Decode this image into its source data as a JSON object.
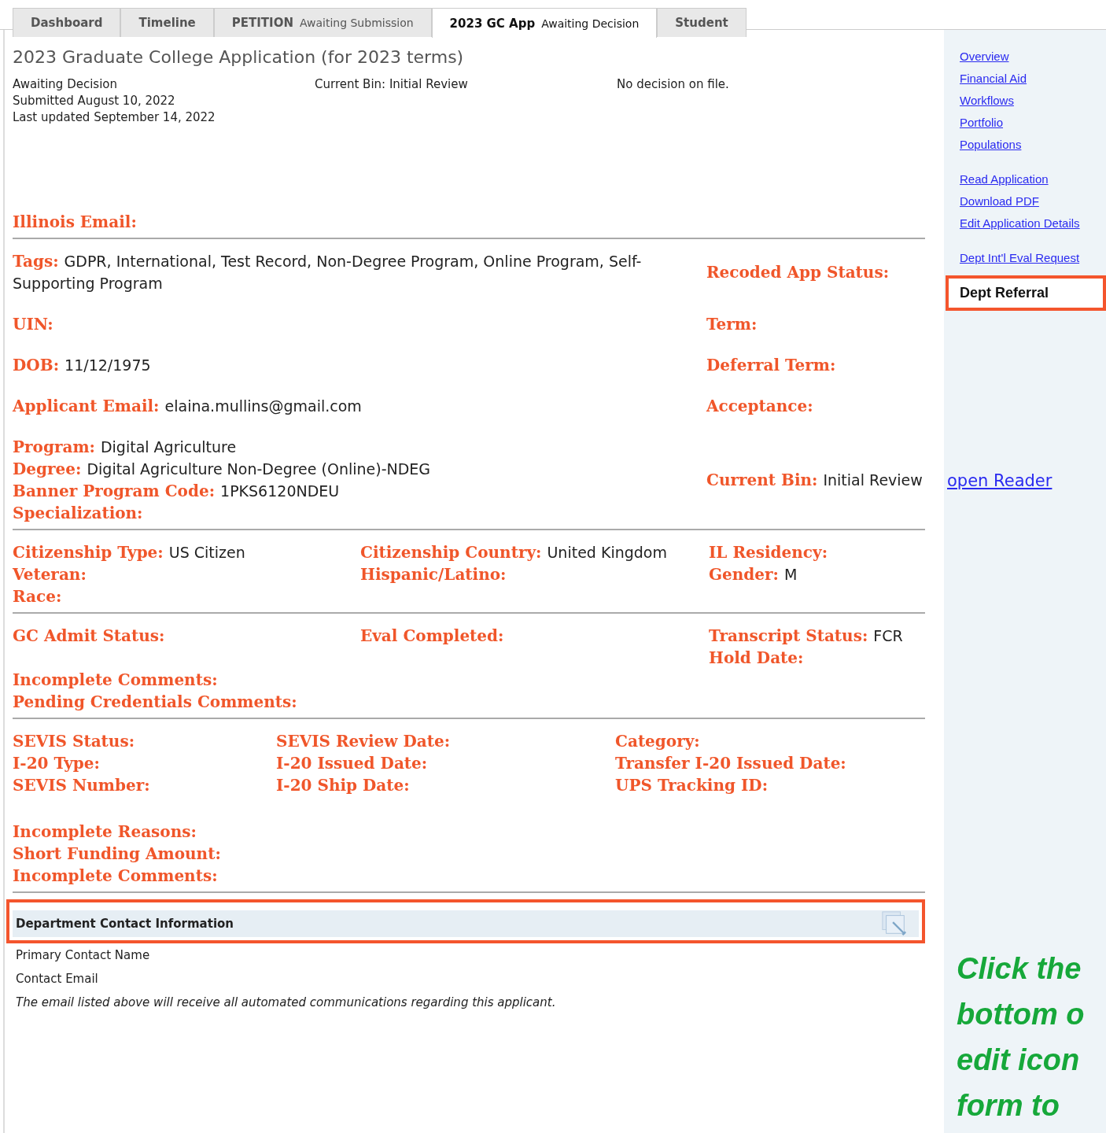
{
  "tabs": [
    {
      "label": "Dashboard",
      "selected": false
    },
    {
      "label": "Timeline",
      "selected": false
    },
    {
      "label": "PETITION",
      "status": "Awaiting Submission",
      "selected": false
    },
    {
      "label": "2023 GC App",
      "status": "Awaiting Decision",
      "selected": true
    },
    {
      "label": "Student",
      "selected": false
    }
  ],
  "header": {
    "title": "2023 Graduate College Application (for 2023 terms)",
    "status": "Awaiting Decision",
    "submitted": "Submitted August 10, 2022",
    "updated": "Last updated September 14, 2022",
    "current_bin": "Current Bin: Initial Review",
    "decision": "No decision on file."
  },
  "sections": [
    {
      "kind": "single",
      "rows": [
        {
          "cells": [
            [
              {
                "label": "Illinois Email:"
              }
            ]
          ]
        }
      ]
    },
    {
      "kind": "wide",
      "rows": [
        {
          "cells": [
            [
              {
                "label": "Tags:",
                "value": "GDPR, International, Test Record, Non-Degree Program, Online Program, Self-Supporting Program"
              }
            ],
            [
              {
                "label": "Recoded App Status:"
              }
            ]
          ]
        },
        {
          "cells": [
            [
              {
                "label": "UIN:"
              }
            ],
            [
              {
                "label": "Term:"
              }
            ]
          ]
        },
        {
          "cells": [
            [
              {
                "label": "DOB:",
                "value": "11/12/1975"
              }
            ],
            [
              {
                "label": "Deferral Term:"
              }
            ]
          ]
        },
        {
          "cells": [
            [
              {
                "label": "Applicant Email:",
                "value": "elaina.mullins@gmail.com"
              }
            ],
            [
              {
                "label": "Acceptance:"
              }
            ]
          ]
        },
        {
          "cells": [
            [
              {
                "label": "Program:",
                "value": "Digital Agriculture"
              },
              {
                "label": "Degree:",
                "value": "Digital Agriculture Non-Degree (Online)-NDEG"
              },
              {
                "label": "Banner Program Code:",
                "value": "1PKS6120NDEU"
              },
              {
                "label": "Specialization:"
              }
            ],
            [
              {
                "label": "Current Bin:",
                "value": "Initial Review",
                "link": "open Reader"
              }
            ]
          ]
        }
      ]
    },
    {
      "kind": "three",
      "rows": [
        {
          "cells": [
            [
              {
                "label": "Citizenship Type:",
                "value": "US Citizen"
              },
              {
                "label": "Veteran:"
              },
              {
                "label": "Race:"
              }
            ],
            [
              {
                "label": "Citizenship Country:",
                "value": "United Kingdom"
              },
              {
                "label": "Hispanic/Latino:"
              }
            ],
            [
              {
                "label": "IL Residency:"
              },
              {
                "label": "Gender:",
                "value": "M"
              }
            ]
          ]
        }
      ]
    },
    {
      "kind": "three",
      "rows": [
        {
          "cells": [
            [
              {
                "label": "GC Admit Status:"
              }
            ],
            [
              {
                "label": "Eval Completed:"
              }
            ],
            [
              {
                "label": "Transcript Status:",
                "value": "FCR"
              },
              {
                "label": "Hold Date:"
              }
            ]
          ]
        },
        {
          "cells": [
            [
              {
                "label": "Incomplete Comments:"
              },
              {
                "label": "Pending Credentials Comments:"
              }
            ]
          ]
        }
      ]
    },
    {
      "kind": "sevis",
      "rows": [
        {
          "cells": [
            [
              {
                "label": "SEVIS Status:"
              },
              {
                "label": "I-20 Type:"
              },
              {
                "label": "SEVIS Number:"
              }
            ],
            [
              {
                "label": "SEVIS Review Date:"
              },
              {
                "label": "I-20 Issued Date:"
              },
              {
                "label": "I-20 Ship Date:"
              }
            ],
            [
              {
                "label": "Category:"
              },
              {
                "label": "Transfer I-20 Issued Date:"
              },
              {
                "label": "UPS Tracking ID:"
              }
            ]
          ]
        },
        {
          "cells": [
            [
              {
                "label": "Incomplete Reasons:"
              },
              {
                "label": "Short Funding Amount:"
              },
              {
                "label": "Incomplete Comments:"
              }
            ]
          ]
        }
      ]
    }
  ],
  "contact": {
    "title": "Department Contact Information",
    "fields": [
      "Primary Contact Name",
      "Contact Email"
    ],
    "note": "The email listed above will receive all automated communications regarding this applicant."
  },
  "sidebar": {
    "groups": [
      [
        "Overview",
        "Financial Aid",
        "Workflows",
        "Portfolio",
        "Populations"
      ],
      [
        "Read Application",
        "Download PDF",
        "Edit Application Details"
      ],
      [
        "Dept Int'l Eval Request"
      ]
    ],
    "highlighted": "Dept Referral"
  },
  "callout": [
    "Click the",
    "bottom o",
    "edit icon",
    "form  to"
  ]
}
